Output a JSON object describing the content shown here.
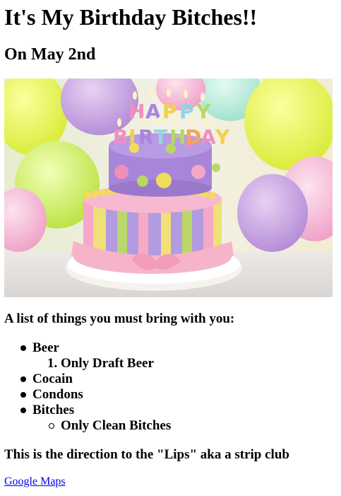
{
  "header": {
    "title": "It's My Birthday Bitches!!",
    "subtitle": "On May 2nd"
  },
  "image": {
    "cake_text_top": "HAPPY",
    "cake_text_bottom": "BIRTHDAY"
  },
  "list": {
    "heading": "A list of things you must bring with you:",
    "items": [
      {
        "label": "Beer",
        "sub_number": "1.",
        "sub_label": "Only Draft Beer"
      },
      {
        "label": "Cocain"
      },
      {
        "label": "Condons"
      },
      {
        "label": "Bitches",
        "sub_label": "Only Clean Bitches"
      }
    ]
  },
  "directions": {
    "heading": "This is the direction to the \"Lips\" aka a strip club",
    "link_label": "Google Maps"
  },
  "colors": {
    "link": "#0000ee",
    "text": "#000000"
  }
}
